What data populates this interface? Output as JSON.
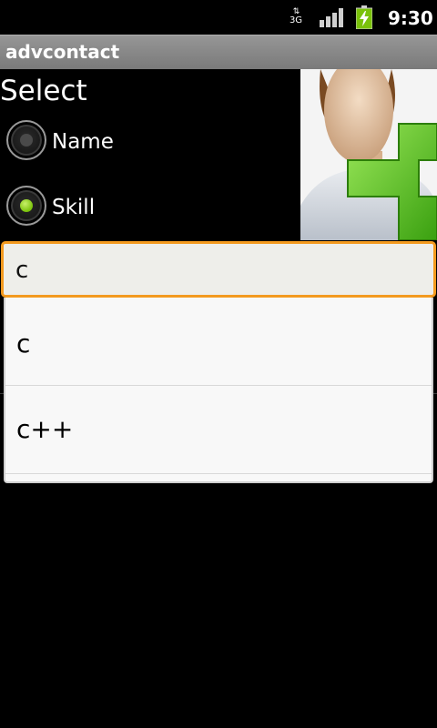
{
  "status_bar": {
    "network_label": "3G",
    "time": "9:30",
    "icons": [
      "data-arrows-icon",
      "signal-icon",
      "battery-charging-icon"
    ]
  },
  "app": {
    "title": "advcontact"
  },
  "form": {
    "heading": "Select",
    "options": [
      {
        "label": "Name",
        "checked": false
      },
      {
        "label": "Skill",
        "checked": true
      }
    ],
    "image": "add-contact-image"
  },
  "autocomplete": {
    "value": "c",
    "suggestions": [
      "c",
      "c++"
    ]
  },
  "colors": {
    "focus_border": "#f39a1f",
    "radio_checked": "#7ac20a",
    "title_bar": "#8a8a8a"
  }
}
